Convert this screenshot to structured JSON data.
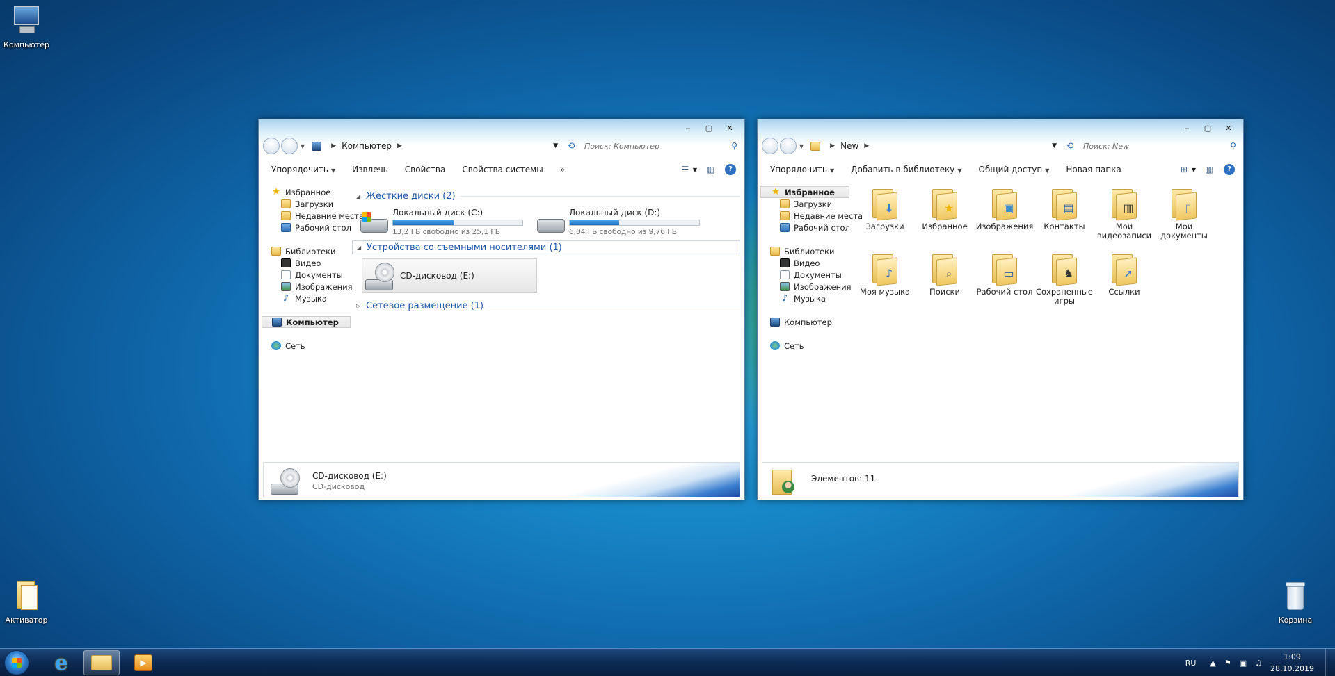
{
  "desktop": {
    "icons": [
      {
        "label": "Компьютер"
      },
      {
        "label": "Активатор"
      },
      {
        "label": "Корзина"
      }
    ]
  },
  "left_window": {
    "caption": {
      "minimize": "‒",
      "maximize": "▢",
      "close": "✕"
    },
    "address": {
      "crumb": "Компьютер"
    },
    "search_placeholder": "Поиск: Компьютер",
    "toolbar": {
      "organize": "Упорядочить",
      "eject": "Извлечь",
      "properties": "Свойства",
      "system_properties": "Свойства системы",
      "more": "»"
    },
    "nav": {
      "favorites": "Избранное",
      "downloads": "Загрузки",
      "recent": "Недавние места",
      "desktop": "Рабочий стол",
      "libraries": "Библиотеки",
      "video": "Видео",
      "documents": "Документы",
      "images": "Изображения",
      "music": "Музыка",
      "computer": "Компьютер",
      "network": "Сеть"
    },
    "groups": {
      "hdd": "Жесткие диски (2)",
      "removable": "Устройства со съемными носителями (1)",
      "network": "Сетевое размещение (1)"
    },
    "drives": [
      {
        "name": "Локальный диск (C:)",
        "free": "13,2 ГБ свободно из 25,1 ГБ",
        "used_fraction": 0.47
      },
      {
        "name": "Локальный диск (D:)",
        "free": "6,04 ГБ свободно из 9,76 ГБ",
        "used_fraction": 0.38
      }
    ],
    "cd": {
      "name": "CD-дисковод (E:)"
    },
    "details": {
      "title": "CD-дисковод (E:)",
      "subtitle": "CD-дисковод"
    }
  },
  "right_window": {
    "caption": {
      "minimize": "‒",
      "maximize": "▢",
      "close": "✕"
    },
    "address": {
      "crumb": "New"
    },
    "search_placeholder": "Поиск: New",
    "toolbar": {
      "organize": "Упорядочить",
      "add_library": "Добавить в библиотеку",
      "share": "Общий доступ",
      "new_folder": "Новая папка"
    },
    "nav": {
      "favorites": "Избранное",
      "downloads": "Загрузки",
      "recent": "Недавние места",
      "desktop": "Рабочий стол",
      "libraries": "Библиотеки",
      "video": "Видео",
      "documents": "Документы",
      "images": "Изображения",
      "music": "Музыка",
      "computer": "Компьютер",
      "network": "Сеть"
    },
    "folders": [
      {
        "label": "Загрузки",
        "emblem": "⬇",
        "color": "#2f7fd6"
      },
      {
        "label": "Избранное",
        "emblem": "★",
        "color": "#f0b400"
      },
      {
        "label": "Изображения",
        "emblem": "▣",
        "color": "#3d8bd0"
      },
      {
        "label": "Контакты",
        "emblem": "▤",
        "color": "#3d6fb0"
      },
      {
        "label": "Мои видеозаписи",
        "emblem": "▥",
        "color": "#333333"
      },
      {
        "label": "Мои документы",
        "emblem": "▯",
        "color": "#6d8cb0"
      },
      {
        "label": "Моя музыка",
        "emblem": "♪",
        "color": "#2a6fb5"
      },
      {
        "label": "Поиски",
        "emblem": "⌕",
        "color": "#6d6d6d"
      },
      {
        "label": "Рабочий стол",
        "emblem": "▭",
        "color": "#2c5fa8"
      },
      {
        "label": "Сохраненные игры",
        "emblem": "♞",
        "color": "#333333"
      },
      {
        "label": "Ссылки",
        "emblem": "➚",
        "color": "#2f7fd6"
      }
    ],
    "details": {
      "count": "Элементов: 11"
    }
  },
  "taskbar": {
    "lang": "RU",
    "tray_arrow": "▲",
    "time": "1:09",
    "date": "28.10.2019"
  }
}
